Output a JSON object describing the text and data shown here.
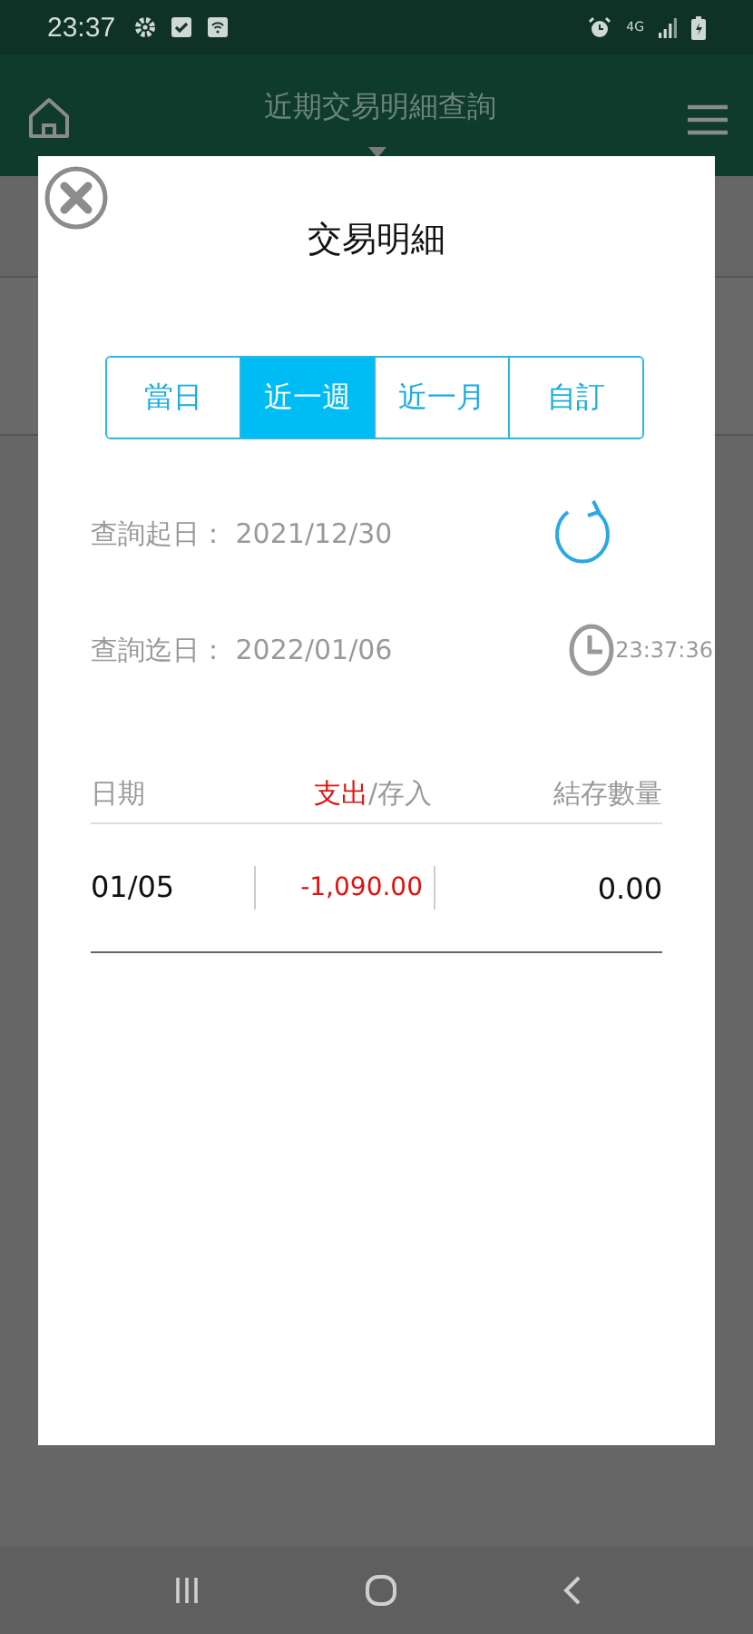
{
  "status_bar": {
    "time": "23:37",
    "network": "4G"
  },
  "header": {
    "title": "近期交易明細查詢"
  },
  "dialog": {
    "title": "交易明細",
    "tabs": [
      {
        "label": "當日",
        "selected": false
      },
      {
        "label": "近一週",
        "selected": true
      },
      {
        "label": "近一月",
        "selected": false
      },
      {
        "label": "自訂",
        "selected": false
      }
    ],
    "query": [
      {
        "label": "查詢起日：",
        "value": "2021/12/30"
      },
      {
        "label": "查詢迄日：",
        "value": "2022/01/06"
      }
    ],
    "updated_time": "23:37:36",
    "table": {
      "columns": [
        [
          {
            "text": "日期",
            "kind": "plain"
          }
        ],
        [
          {
            "text": "支出",
            "kind": "expense"
          },
          {
            "text": "/存入",
            "kind": "plain"
          }
        ],
        [
          {
            "text": "結存數量",
            "kind": "plain"
          }
        ]
      ],
      "rows": [
        {
          "date": "01/05",
          "amount": "-1,090.00",
          "kind": "expense",
          "balance": "0.00"
        }
      ]
    }
  }
}
